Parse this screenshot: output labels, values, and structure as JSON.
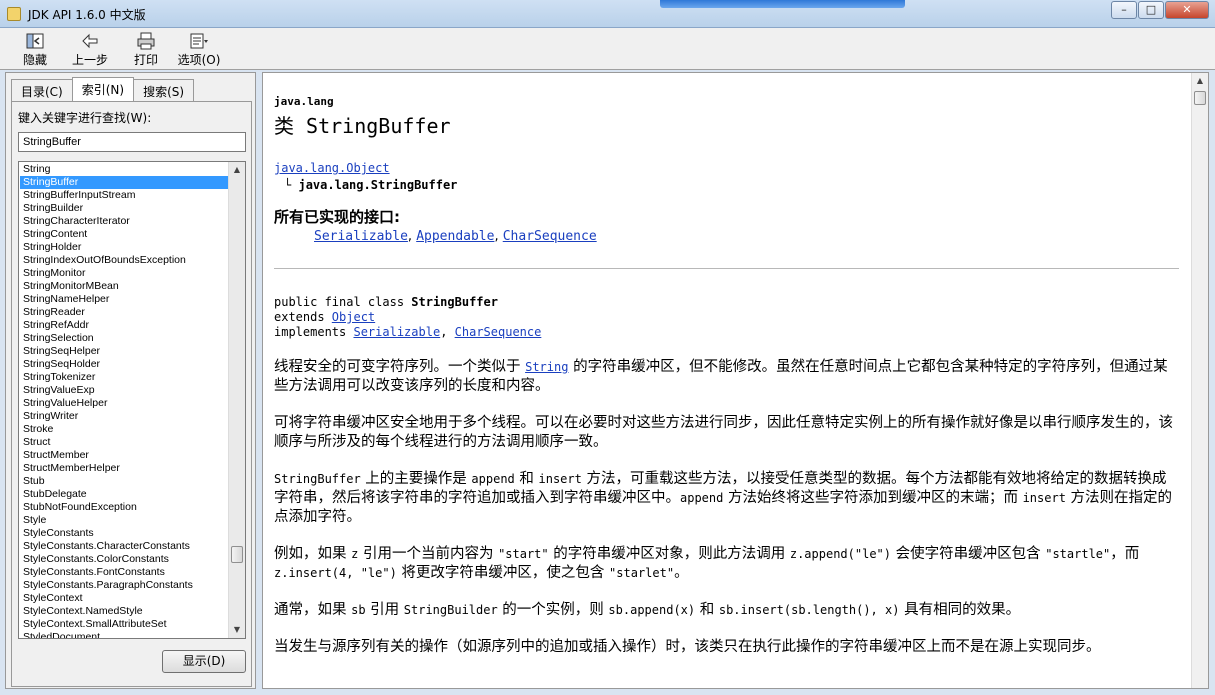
{
  "window": {
    "title": "JDK API 1.6.0 中文版",
    "minimize": "–",
    "maximize": "□",
    "close": "✕"
  },
  "toolbar": {
    "hide": "隐藏",
    "back": "上一步",
    "print": "打印",
    "options": "选项(O)"
  },
  "left": {
    "tabs": [
      "目录(C)",
      "索引(N)",
      "搜索(S)"
    ],
    "keyword_label": "键入关键字进行查找(W):",
    "keyword_value": "StringBuffer",
    "show_button": "显示(D)",
    "selected_index": 1,
    "items": [
      "String",
      "StringBuffer",
      "StringBufferInputStream",
      "StringBuilder",
      "StringCharacterIterator",
      "StringContent",
      "StringHolder",
      "StringIndexOutOfBoundsException",
      "StringMonitor",
      "StringMonitorMBean",
      "StringNameHelper",
      "StringReader",
      "StringRefAddr",
      "StringSelection",
      "StringSeqHelper",
      "StringSeqHolder",
      "StringTokenizer",
      "StringValueExp",
      "StringValueHelper",
      "StringWriter",
      "Stroke",
      "Struct",
      "StructMember",
      "StructMemberHelper",
      "Stub",
      "StubDelegate",
      "StubNotFoundException",
      "Style",
      "StyleConstants",
      "StyleConstants.CharacterConstants",
      "StyleConstants.ColorConstants",
      "StyleConstants.FontConstants",
      "StyleConstants.ParagraphConstants",
      "StyleContext",
      "StyleContext.NamedStyle",
      "StyleContext.SmallAttributeSet",
      "StyledDocument"
    ]
  },
  "doc": {
    "package": "java.lang",
    "class_title": "类 StringBuffer",
    "hier_parent": "java.lang.Object",
    "hier_child": "java.lang.StringBuffer",
    "hier_branch": "└",
    "interfaces_heading": "所有已实现的接口:",
    "interfaces": [
      "Serializable",
      "Appendable",
      "CharSequence"
    ],
    "sep": ", ",
    "decl": {
      "line1_prefix": "public final class ",
      "line1_name": "StringBuffer",
      "line2_prefix": "extends ",
      "line2_link": "Object",
      "line3_prefix": "implements ",
      "line3_links": [
        "Serializable",
        "CharSequence"
      ]
    },
    "p1": {
      "a": "线程安全的可变字符序列。一个类似于 ",
      "code": "String",
      "b": " 的字符串缓冲区，但不能修改。虽然在任意时间点上它都包含某种特定的字符序列，但通过某些方法调用可以改变该序列的长度和内容。"
    },
    "p2": "可将字符串缓冲区安全地用于多个线程。可以在必要时对这些方法进行同步，因此任意特定实例上的所有操作就好像是以串行顺序发生的，该顺序与所涉及的每个线程进行的方法调用顺序一致。",
    "p3": {
      "c1": "StringBuffer",
      "t1": " 上的主要操作是 ",
      "c2": "append",
      "t2": " 和 ",
      "c3": "insert",
      "t3": " 方法，可重载这些方法，以接受任意类型的数据。每个方法都能有效地将给定的数据转换成字符串，然后将该字符串的字符追加或插入到字符串缓冲区中。",
      "c4": "append",
      "t4": " 方法始终将这些字符添加到缓冲区的末端；而 ",
      "c5": "insert",
      "t5": " 方法则在指定的点添加字符。"
    },
    "p4": {
      "t1": "例如，如果 ",
      "c1": "z",
      "t2": " 引用一个当前内容为 ",
      "c2": "\"start\"",
      "t3": " 的字符串缓冲区对象，则此方法调用 ",
      "c3": "z.append(\"le\")",
      "t4": " 会使字符串缓冲区包含 ",
      "c4": "\"startle\"",
      "t5": "，而 ",
      "c5": "z.insert(4, \"le\")",
      "t6": " 将更改字符串缓冲区，使之包含 ",
      "c6": "\"starlet\"",
      "t7": "。"
    },
    "p5": {
      "t1": "通常，如果 ",
      "c1": "sb",
      "t2": " 引用 ",
      "c2": "StringBuilder",
      "t3": " 的一个实例，则 ",
      "c3": "sb.append(x)",
      "t4": " 和 ",
      "c4": "sb.insert(sb.length(), x)",
      "t5": " 具有相同的效果。"
    },
    "p6": "当发生与源序列有关的操作（如源序列中的追加或插入操作）时，该类只在执行此操作的字符串缓冲区上而不是在源上实现同步。"
  }
}
